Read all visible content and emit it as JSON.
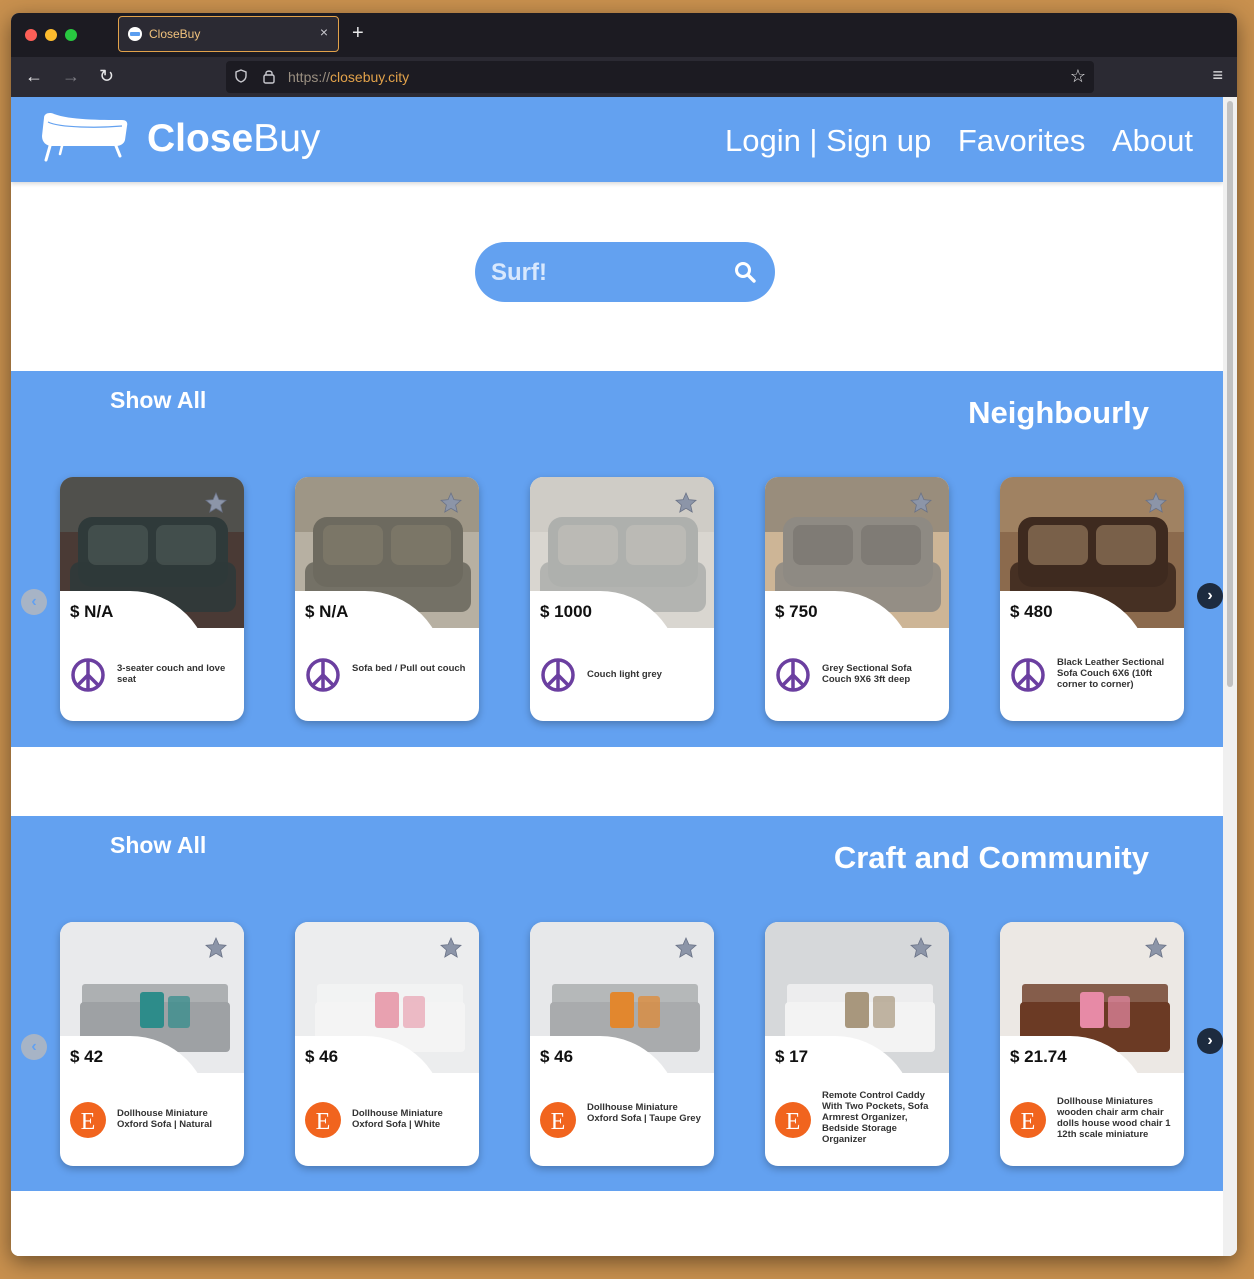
{
  "browser": {
    "tab_title": "CloseBuy",
    "tab_close": "×",
    "new_tab": "+",
    "url_scheme": "https://",
    "url_host": "closebuy.city",
    "back": "←",
    "forward": "→",
    "reload": "↻",
    "bookmark": "☆",
    "menu": "≡"
  },
  "header": {
    "brand_bold": "Close",
    "brand_light": "Buy",
    "nav": [
      "Login | Sign up",
      "Favorites",
      "About"
    ]
  },
  "search": {
    "placeholder": "Surf!"
  },
  "sections": [
    {
      "show_all": "Show All",
      "title": "Neighbourly",
      "source_icon": "peace-icon",
      "items": [
        {
          "price": "$ N/A",
          "desc": "3-seater couch and love seat"
        },
        {
          "price": "$ N/A",
          "desc": "Sofa bed / Pull out couch"
        },
        {
          "price": "$ 1000",
          "desc": "Couch light grey"
        },
        {
          "price": "$ 750",
          "desc": "Grey Sectional Sofa Couch 9X6 3ft deep"
        },
        {
          "price": "$ 480",
          "desc": "Black Leather Sectional Sofa Couch 6X6 (10ft corner to corner)"
        }
      ]
    },
    {
      "show_all": "Show All",
      "title": "Craft and Community",
      "source_icon": "etsy-icon",
      "items": [
        {
          "price": "$ 42",
          "desc": "Dollhouse Miniature Oxford Sofa | Natural"
        },
        {
          "price": "$ 46",
          "desc": "Dollhouse Miniature Oxford Sofa | White"
        },
        {
          "price": "$ 46",
          "desc": "Dollhouse Miniature Oxford Sofa | Taupe Grey"
        },
        {
          "price": "$ 17",
          "desc": "Remote Control Caddy With Two Pockets,  Sofa Armrest Organizer, Bedside Storage Organizer"
        },
        {
          "price": "$ 21.74",
          "desc": "Dollhouse Miniatures wooden chair arm chair dolls house wood chair 1 12th scale miniature"
        }
      ]
    }
  ],
  "colors": {
    "brand_blue": "#63a1f0",
    "peace_purple": "#6b3fa0",
    "etsy_orange": "#f1641e"
  }
}
